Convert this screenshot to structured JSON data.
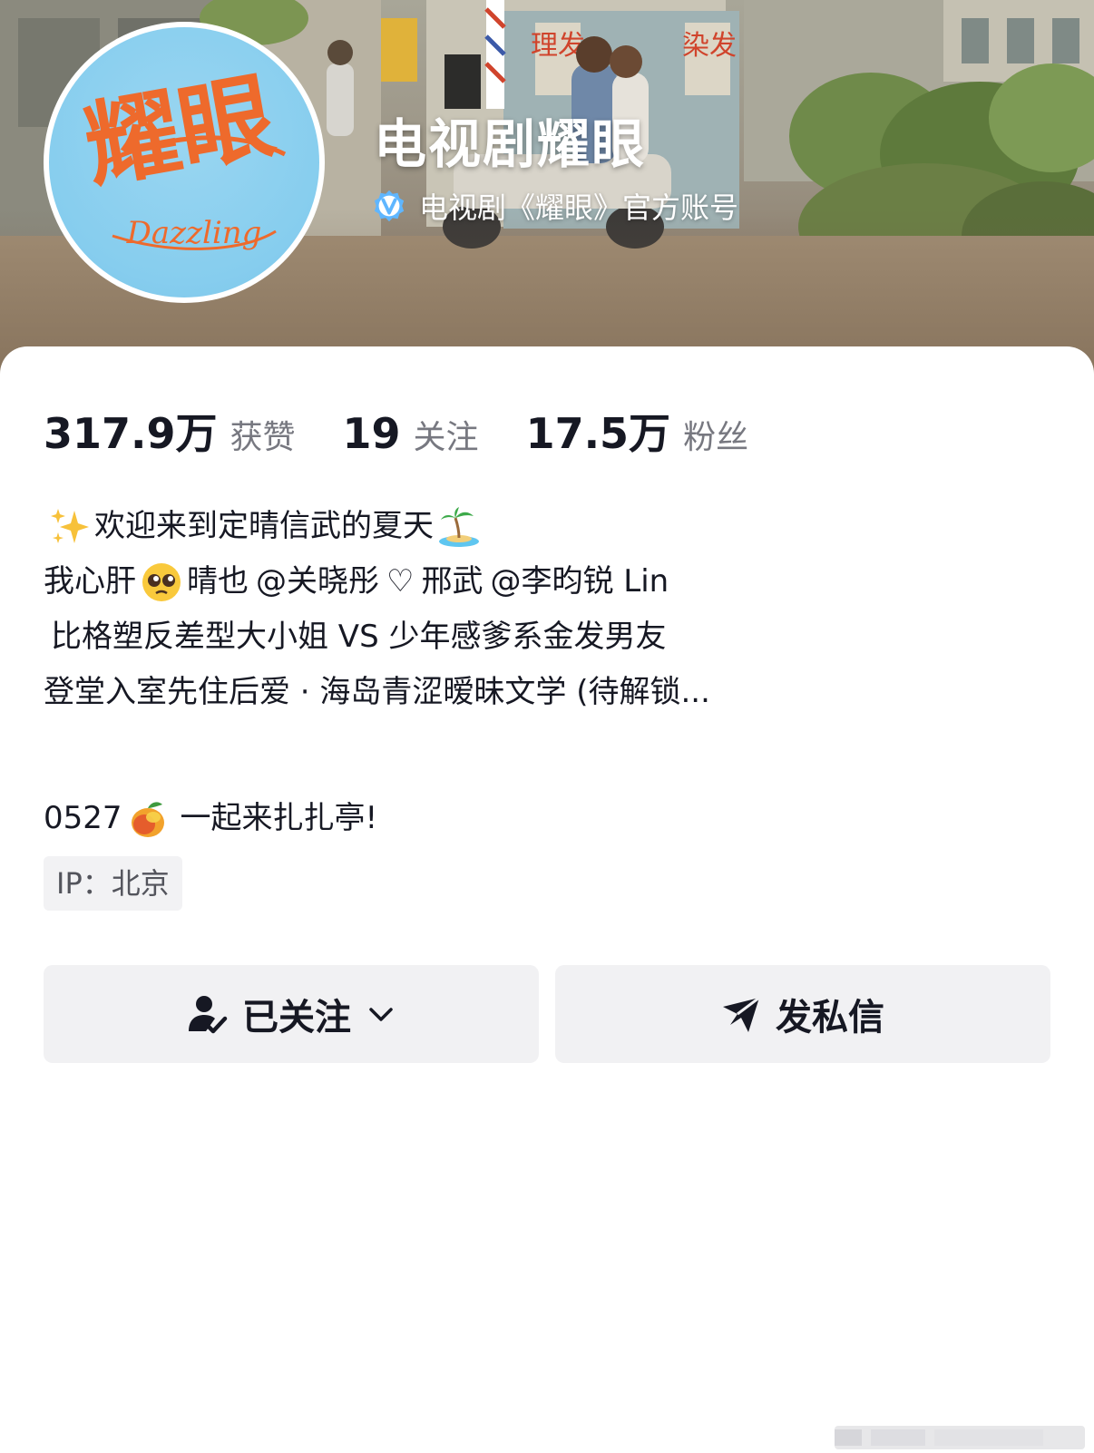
{
  "profile": {
    "name": "电视剧耀眼",
    "verified_label": "电视剧《耀眼》官方账号",
    "avatar_logo_text": "耀眼",
    "avatar_logo_subtitle": "Dazzling",
    "banner_signs": [
      "理发",
      "染发"
    ]
  },
  "stats": [
    {
      "value": "317.9万",
      "label": "获赞"
    },
    {
      "value": "19",
      "label": "关注"
    },
    {
      "value": "17.5万",
      "label": "粉丝"
    }
  ],
  "bio": {
    "line1_text": "欢迎来到定晴信武的夏天",
    "line2_a": "我心肝",
    "line2_b": "晴也",
    "line2_mention1": "@关晓彤",
    "line2_heart": "♡",
    "line2_c": "邢武",
    "line2_mention2": "@李昀锐 Lin",
    "line3": "比格塑反差型大小姐 VS 少年感爹系金发男友",
    "line4": "登堂入室先住后爱 · 海岛青涩暧昧文学 (待解锁...",
    "line5_a": "0527",
    "line5_b": "一起来扎扎亭!",
    "emojis": [
      "sparkles-emoji",
      "desert-island-emoji",
      "pleading-face-emoji",
      "mango-emoji"
    ]
  },
  "ip": {
    "label": "IP：北京"
  },
  "actions": {
    "follow_label": "已关注",
    "message_label": "发私信"
  },
  "colors": {
    "verify_blue": "#5fb6ff",
    "avatar_bg": "#86cdee",
    "logo_orange": "#ee6a2c",
    "button_bg": "#f1f1f3",
    "ip_bg": "#f2f2f4"
  },
  "icons": [
    "verified-icon",
    "user-check-icon",
    "chevron-down-icon",
    "send-icon"
  ]
}
